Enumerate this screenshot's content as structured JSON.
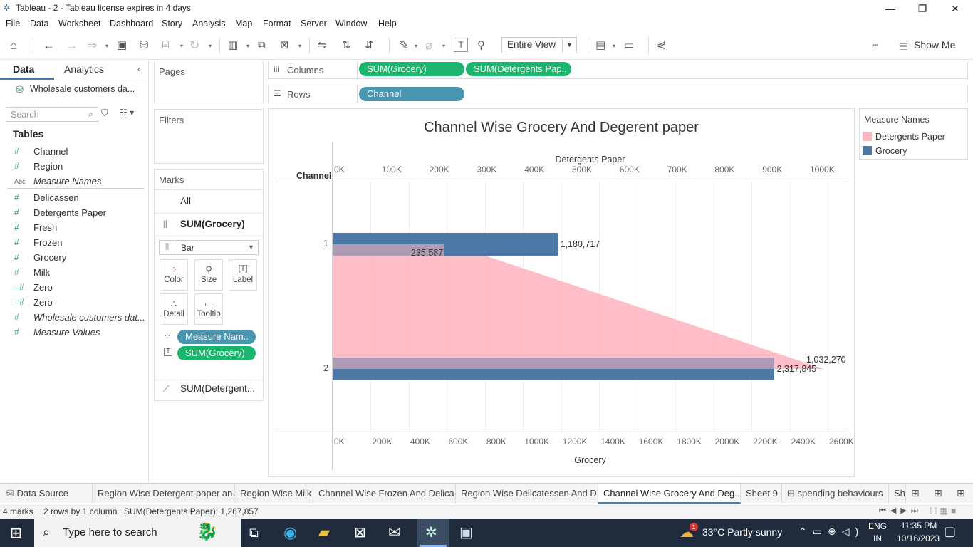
{
  "window": {
    "title": "Tableau - 2 - Tableau license expires in 4 days"
  },
  "menu": [
    "File",
    "Data",
    "Worksheet",
    "Dashboard",
    "Story",
    "Analysis",
    "Map",
    "Format",
    "Server",
    "Window",
    "Help"
  ],
  "toolbar": {
    "view_select": "Entire View",
    "show_me": "Show Me"
  },
  "left": {
    "tab_data": "Data",
    "tab_analytics": "Analytics",
    "datasource": "Wholesale customers da...",
    "search_placeholder": "Search",
    "tables_label": "Tables",
    "fields": [
      {
        "icon": "#",
        "name": "Channel",
        "italic": false
      },
      {
        "icon": "#",
        "name": "Region",
        "italic": false
      },
      {
        "icon": "Abc",
        "name": "Measure Names",
        "italic": true
      },
      {
        "icon": "#",
        "name": "Delicassen",
        "italic": false
      },
      {
        "icon": "#",
        "name": "Detergents Paper",
        "italic": false
      },
      {
        "icon": "#",
        "name": "Fresh",
        "italic": false
      },
      {
        "icon": "#",
        "name": "Frozen",
        "italic": false
      },
      {
        "icon": "#",
        "name": "Grocery",
        "italic": false
      },
      {
        "icon": "#",
        "name": "Milk",
        "italic": false
      },
      {
        "icon": "=#",
        "name": "Zero",
        "italic": false
      },
      {
        "icon": "=#",
        "name": "Zero",
        "italic": false
      },
      {
        "icon": "#",
        "name": "Wholesale customers dat...",
        "italic": true
      },
      {
        "icon": "#",
        "name": "Measure Values",
        "italic": true
      }
    ]
  },
  "cards": {
    "pages": "Pages",
    "filters": "Filters",
    "marks": "Marks",
    "marks_all": "All",
    "marks_grocery": "SUM(Grocery)",
    "mark_type": "Bar",
    "buttons": {
      "color": "Color",
      "size": "Size",
      "label": "Label",
      "detail": "Detail",
      "tooltip": "Tooltip"
    },
    "pill_measure_names": "Measure Nam..",
    "pill_sum_grocery": "SUM(Grocery)",
    "marks_detergent": "SUM(Detergent..."
  },
  "shelves": {
    "columns_label": "Columns",
    "rows_label": "Rows",
    "columns_pills": [
      "SUM(Grocery)",
      "SUM(Detergents Pap.."
    ],
    "rows_pills": [
      "Channel"
    ]
  },
  "legend": {
    "title": "Measure Names",
    "items": [
      {
        "label": "Detergents Paper",
        "color": "#ffb6c1"
      },
      {
        "label": "Grocery",
        "color": "#4e79a7"
      }
    ]
  },
  "chart_data": {
    "type": "bar",
    "title": "Channel Wise Grocery And Degerent paper",
    "row_header": "Channel",
    "categories": [
      "1",
      "2"
    ],
    "series": [
      {
        "name": "Grocery",
        "values": [
          1180717,
          2317845
        ],
        "color": "#4e79a7",
        "labels": [
          "1,180,717",
          "2,317,845"
        ]
      },
      {
        "name": "Detergents Paper",
        "values": [
          235587,
          1032270
        ],
        "color": "#ffb6c1",
        "labels": [
          "235,587",
          "1,032,270"
        ]
      }
    ],
    "x_bottom": {
      "label": "Grocery",
      "ticks": [
        "0K",
        "200K",
        "400K",
        "600K",
        "800K",
        "1000K",
        "1200K",
        "1400K",
        "1600K",
        "1800K",
        "2000K",
        "2200K",
        "2400K",
        "2600K"
      ],
      "max": 2600000
    },
    "x_top": {
      "label": "Detergents Paper",
      "ticks": [
        "0K",
        "100K",
        "200K",
        "300K",
        "400K",
        "500K",
        "600K",
        "700K",
        "800K",
        "900K",
        "1000K"
      ],
      "max": 1000000
    }
  },
  "sheet_tabs": [
    {
      "label": "Data Source",
      "active": false
    },
    {
      "label": "Region Wise Detergent paper an...",
      "active": false
    },
    {
      "label": "Region Wise Milk",
      "active": false
    },
    {
      "label": "Channel Wise Frozen And Delica...",
      "active": false
    },
    {
      "label": "Region Wise Delicatessen And D...",
      "active": false
    },
    {
      "label": "Channel Wise Grocery And Deg...",
      "active": true
    },
    {
      "label": "Sheet 9",
      "active": false
    },
    {
      "label": "spending  behaviours",
      "active": false
    },
    {
      "label": "Sh",
      "active": false
    }
  ],
  "status": {
    "marks": "4 marks",
    "dims": "2 rows by 1 column",
    "sum": "SUM(Detergents Paper): 1,267,857"
  },
  "taskbar": {
    "search": "Type here to search",
    "weather": "33°C  Partly sunny",
    "lang1": "ENG",
    "lang2": "IN",
    "time": "11:35 PM",
    "date": "10/16/2023",
    "notif_badge": "1"
  }
}
